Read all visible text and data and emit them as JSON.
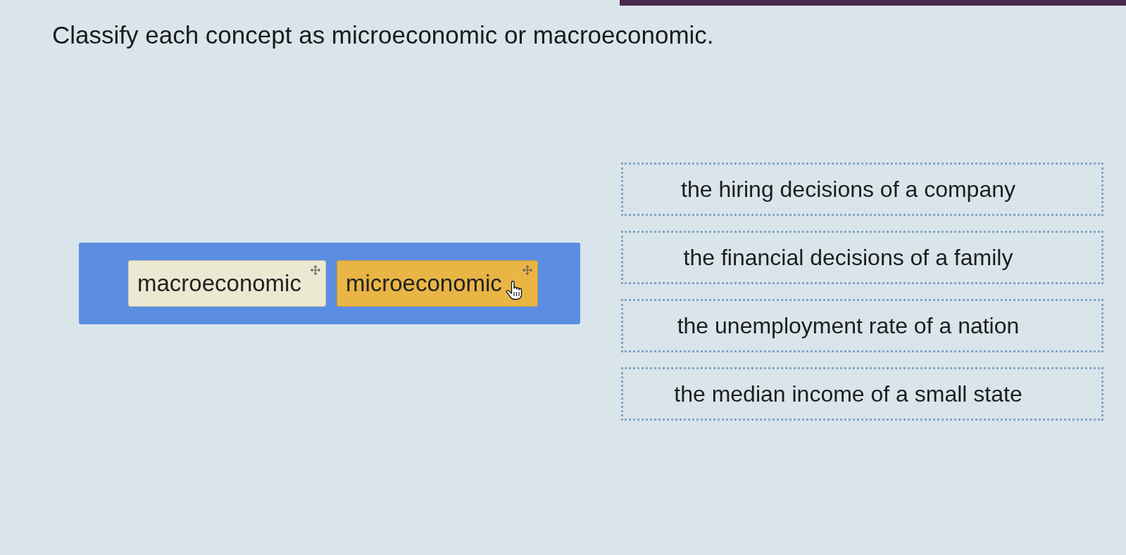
{
  "prompt": {
    "text": "Classify each concept as microeconomic or macroeconomic."
  },
  "answer_bank": {
    "chips": [
      {
        "label": "macroeconomic",
        "selected": false
      },
      {
        "label": "microeconomic",
        "selected": true
      }
    ]
  },
  "drop_zones": [
    {
      "text": "the hiring decisions of a company"
    },
    {
      "text": "the financial decisions of a family"
    },
    {
      "text": "the unemployment rate of a nation"
    },
    {
      "text": "the median income of a small state"
    }
  ]
}
